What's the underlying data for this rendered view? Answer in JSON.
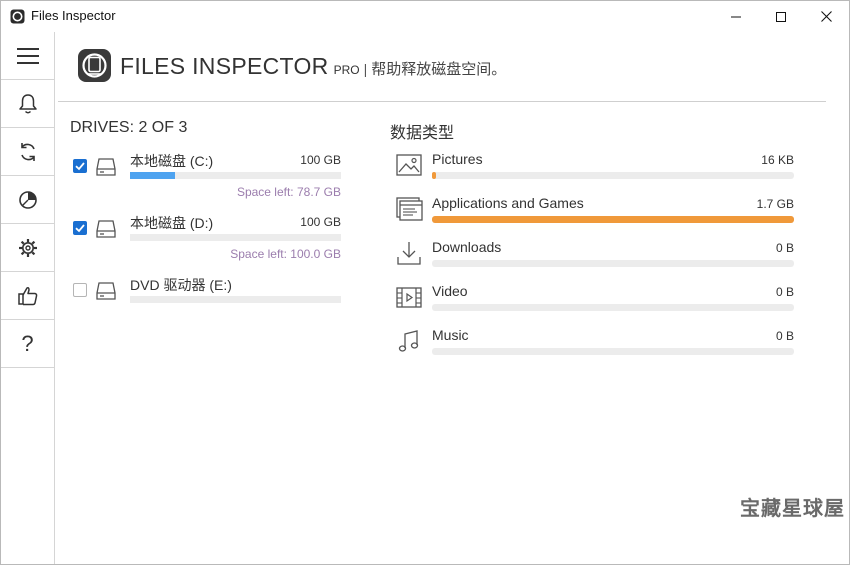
{
  "window": {
    "title": "Files Inspector"
  },
  "nav": [
    {
      "icon": "menu-icon"
    },
    {
      "icon": "bell-icon"
    },
    {
      "icon": "refresh-icon"
    },
    {
      "icon": "chart-icon"
    },
    {
      "icon": "gear-icon"
    },
    {
      "icon": "thumbs-up-icon"
    },
    {
      "icon": "help-icon",
      "label": "?"
    }
  ],
  "header": {
    "brand": "FILES INSPECTOR",
    "edition": "PRO",
    "separator": "|",
    "tagline": "帮助释放磁盘空间。"
  },
  "drives": {
    "title": "DRIVES: 2 OF 3",
    "items": [
      {
        "name": "本地磁盘 (C:)",
        "size": "100 GB",
        "space_left": "Space left: 78.7 GB",
        "used_fraction": 0.213,
        "checked": true
      },
      {
        "name": "本地磁盘 (D:)",
        "size": "100 GB",
        "space_left": "Space left: 100.0 GB",
        "used_fraction": 0.0,
        "checked": true
      },
      {
        "name": "DVD 驱动器 (E:)",
        "size": "",
        "space_left": "",
        "used_fraction": 0.0,
        "checked": false
      }
    ]
  },
  "types": {
    "title": "数据类型",
    "items": [
      {
        "name": "Pictures",
        "size": "16 KB",
        "fraction": 0.01,
        "icon": "picture-icon"
      },
      {
        "name": "Applications and Games",
        "size": "1.7 GB",
        "fraction": 1.0,
        "icon": "applications-icon"
      },
      {
        "name": "Downloads",
        "size": "0 B",
        "fraction": 0.0,
        "icon": "download-icon"
      },
      {
        "name": "Video",
        "size": "0 B",
        "fraction": 0.0,
        "icon": "video-icon"
      },
      {
        "name": "Music",
        "size": "0 B",
        "fraction": 0.0,
        "icon": "music-icon"
      }
    ]
  },
  "colors": {
    "drive_bar": "#4ea3f0",
    "type_bar": "#f0993a",
    "checkbox": "#1a6fd1",
    "space_left_text": "#9b7dad"
  },
  "watermark": "宝藏星球屋"
}
